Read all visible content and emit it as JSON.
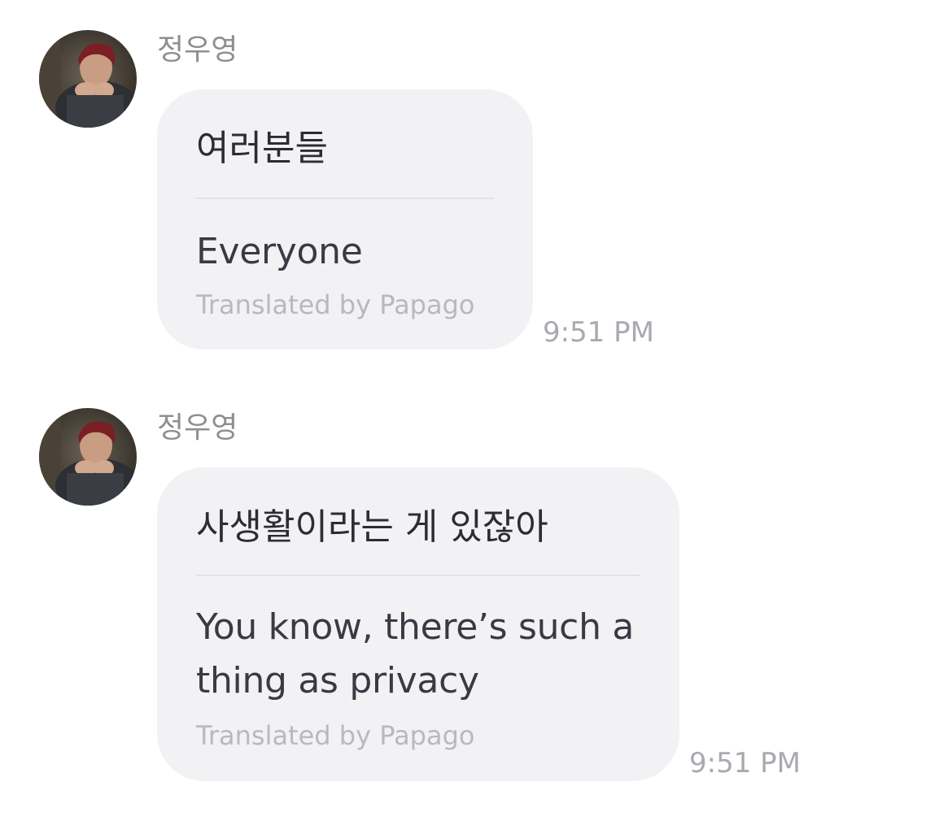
{
  "messages": [
    {
      "sender": "정우영",
      "avatar_icon": "profile-photo",
      "original_text": "여러분들",
      "translated_text": "Everyone",
      "translation_credit": "Translated by Papago",
      "time": "9:51 PM"
    },
    {
      "sender": "정우영",
      "avatar_icon": "profile-photo",
      "original_text": "사생활이라는 게 있잖아",
      "translated_text": "You know, there’s such a thing as privacy",
      "translation_credit": "Translated by Papago",
      "time": "9:51 PM"
    }
  ],
  "colors": {
    "bubble": "#f2f2f5",
    "sender": "#8e8e93",
    "time": "#a9a9b0",
    "credit": "#b8b8bf"
  }
}
